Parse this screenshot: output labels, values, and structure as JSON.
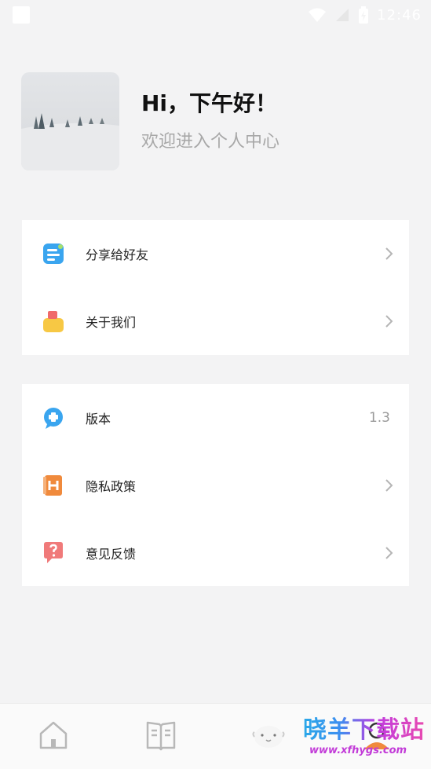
{
  "status_bar": {
    "time": "12:46"
  },
  "header": {
    "greeting": "Hi，下午好！",
    "subtitle": "欢迎进入个人中心"
  },
  "menu_group_1": [
    {
      "label": "分享给好友",
      "icon": "share-icon"
    },
    {
      "label": "关于我们",
      "icon": "about-icon"
    }
  ],
  "menu_group_2": [
    {
      "label": "版本",
      "icon": "version-icon",
      "value": "1.3"
    },
    {
      "label": "隐私政策",
      "icon": "privacy-icon"
    },
    {
      "label": "意见反馈",
      "icon": "feedback-icon"
    }
  ],
  "tab_bar": [
    {
      "name": "home",
      "icon": "home-icon"
    },
    {
      "name": "book",
      "icon": "book-icon"
    },
    {
      "name": "sheep",
      "icon": "sheep-icon"
    },
    {
      "name": "profile",
      "icon": "profile-icon"
    }
  ],
  "watermark": {
    "title": "晓羊下载站",
    "url": "www.xfhygs.com"
  },
  "colors": {
    "background": "#f3f3f4",
    "card": "#ffffff",
    "accent_blue": "#3aa5ef",
    "accent_orange": "#f08a3c",
    "accent_red": "#f07a7a",
    "accent_yellow": "#f7c844"
  }
}
